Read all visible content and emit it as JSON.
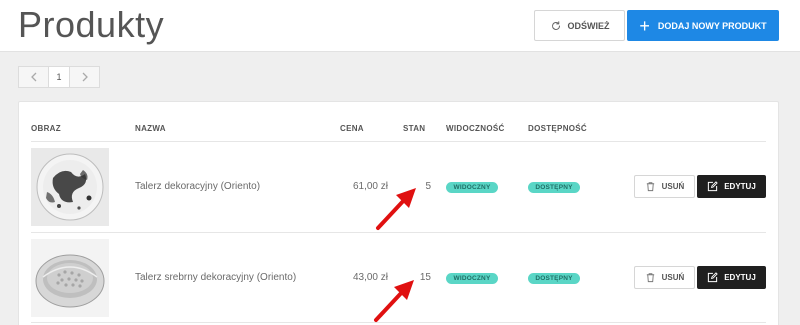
{
  "header": {
    "title": "Produkty",
    "refresh_label": "ODŚWIEŻ",
    "add_label": "DODAJ NOWY PRODUKT"
  },
  "pagination": {
    "current_page": "1"
  },
  "table": {
    "columns": {
      "image": "OBRAZ",
      "name": "NAZWA",
      "price": "CENA",
      "stock": "STAN",
      "visibility": "WIDOCZNOŚĆ",
      "availability": "DOSTĘPNOŚĆ"
    },
    "rows": [
      {
        "name": "Talerz dekoracyjny (Oriento)",
        "price": "61,00 zł",
        "stock": "5",
        "visibility": "WIDOCZNY",
        "availability": "DOSTĘPNY",
        "delete_label": "USUŃ",
        "edit_label": "EDYTUJ"
      },
      {
        "name": "Talerz srebrny dekoracyjny (Oriento)",
        "price": "43,00 zł",
        "stock": "15",
        "visibility": "WIDOCZNY",
        "availability": "DOSTĘPNY",
        "delete_label": "USUŃ",
        "edit_label": "EDYTUJ"
      }
    ]
  },
  "colors": {
    "primary": "#1e88e5",
    "badge": "#5ad6c6",
    "edit_button": "#1f1f1f",
    "annotation_arrow": "#e01010"
  },
  "icons": {
    "refresh": "refresh-icon",
    "add": "plus-icon",
    "delete": "trash-icon",
    "edit": "edit-icon",
    "prev": "chevron-left-icon",
    "next": "chevron-right-icon"
  }
}
